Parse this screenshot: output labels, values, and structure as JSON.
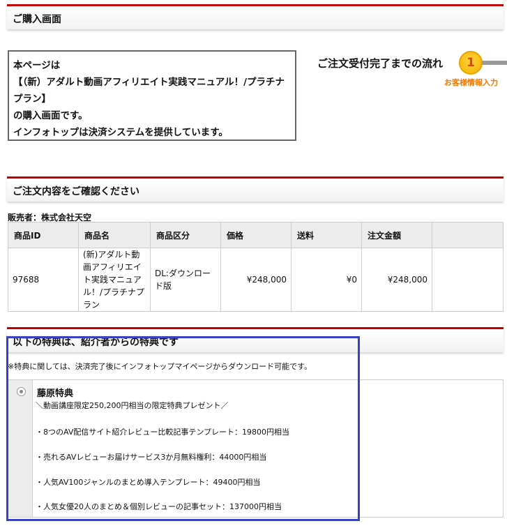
{
  "header": {
    "purchase_title": "ご購入画面"
  },
  "intro": {
    "line1": "本ページは",
    "line2": "【（新）アダルト動画アフィリエイト実践マニュアル！/プラチナプラン】",
    "line3": "の購入画面です。",
    "line4": "インフォトップは決済システムを提供しています。"
  },
  "flow": {
    "title": "ご注文受付完了までの流れ",
    "step_number": "1",
    "step_label": "お客様情報入力"
  },
  "confirm": {
    "title": "ご注文内容をご確認ください",
    "seller": "販売者：株式会社天空",
    "columns": [
      "商品ID",
      "商品名",
      "商品区分",
      "価格",
      "送料",
      "注文金額"
    ],
    "row": {
      "id": "97688",
      "name": "(新)アダルト動画アフィリエイト実践マニュアル！/プラチナプラン",
      "category": "DL:ダウンロード版",
      "price": "¥248,000",
      "shipping": "¥0",
      "total": "¥248,000"
    }
  },
  "bonus": {
    "title": "以下の特典は、紹介者からの特典です",
    "notice": "※特典に関しては、決済完了後にインフォトップマイページからダウンロード可能です。",
    "name": "藤原特典",
    "lines": [
      "＼動画講座限定250,200円相当の限定特典プレゼント／",
      "・8つのAV配信サイト紹介レビュー比較記事テンプレート：19800円相当",
      "・売れるAVレビューお届けサービス3か月無料権利：44000円相当",
      "・人気AV100ジャンルのまとめ導入テンプレート：49400円相当",
      "・人気女優20人のまとめ＆個別レビューの記事セット：137000円相当"
    ]
  },
  "colors": {
    "header_accent": "#c00000",
    "highlight_border": "#3b3fc4",
    "step_orange": "#f07a00"
  }
}
